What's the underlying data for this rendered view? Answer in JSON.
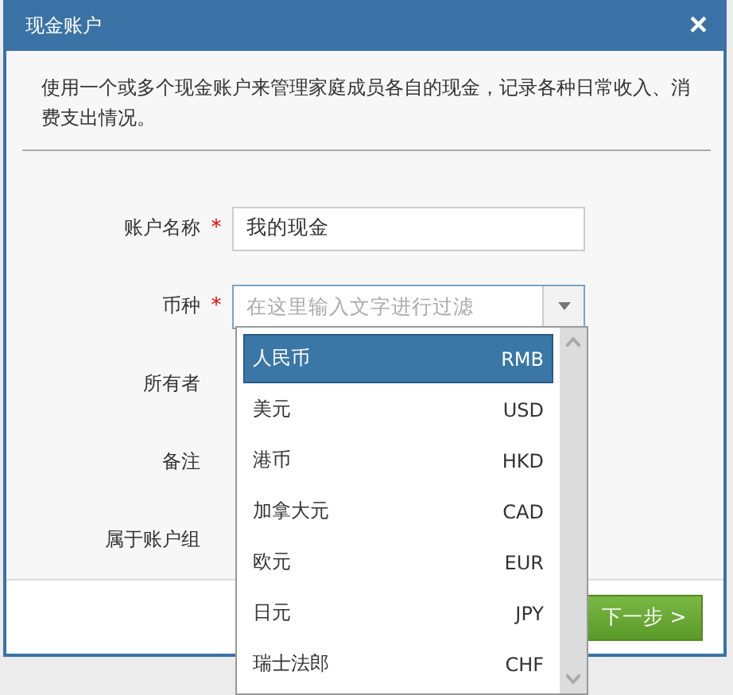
{
  "dialog": {
    "title": "现金账户",
    "close": "×"
  },
  "description": "使用一个或多个现金账户来管理家庭成员各自的现金，记录各种日常收入、消费支出情况。",
  "fields": [
    {
      "label": "账户名称",
      "required": true,
      "kind": "text",
      "value": "我的现金"
    },
    {
      "label": "币种",
      "required": true,
      "kind": "select",
      "placeholder": "在这里输入文字进行过滤",
      "expanded": true
    },
    {
      "label": "所有者",
      "required": false,
      "kind": "empty"
    },
    {
      "label": "备注",
      "required": false,
      "kind": "empty"
    },
    {
      "label": "属于账户组",
      "required": false,
      "kind": "empty"
    }
  ],
  "required_mark": "*",
  "currency_options": [
    {
      "name": "人民币",
      "code": "RMB",
      "selected": true
    },
    {
      "name": "美元",
      "code": "USD",
      "selected": false
    },
    {
      "name": "港币",
      "code": "HKD",
      "selected": false
    },
    {
      "name": "加拿大元",
      "code": "CAD",
      "selected": false
    },
    {
      "name": "欧元",
      "code": "EUR",
      "selected": false
    },
    {
      "name": "日元",
      "code": "JPY",
      "selected": false
    },
    {
      "name": "瑞士法郎",
      "code": "CHF",
      "selected": false
    }
  ],
  "next_button": "下一步 >"
}
